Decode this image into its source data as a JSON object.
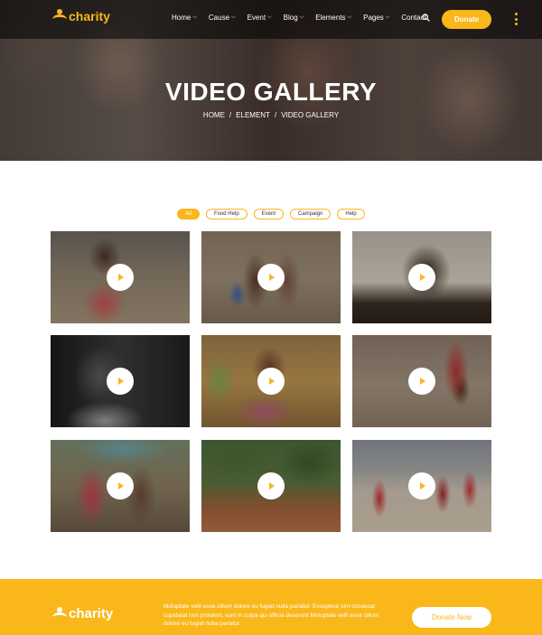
{
  "brand": {
    "name": "charity"
  },
  "nav": {
    "items": [
      {
        "label": "Home",
        "has_dropdown": true
      },
      {
        "label": "Cause",
        "has_dropdown": true
      },
      {
        "label": "Event",
        "has_dropdown": true
      },
      {
        "label": "Blog",
        "has_dropdown": true
      },
      {
        "label": "Elements",
        "has_dropdown": true
      },
      {
        "label": "Pages",
        "has_dropdown": true
      },
      {
        "label": "Contact",
        "has_dropdown": false
      }
    ],
    "search_icon": "search-icon",
    "donate_label": "Donate",
    "menu_icon": "vertical-dots-icon"
  },
  "hero": {
    "title": "VIDEO GALLERY",
    "breadcrumb": [
      "HOME",
      "ELEMENT",
      "VIDEO GALLERY"
    ],
    "separator": "/"
  },
  "filters": {
    "items": [
      "All",
      "Food Help",
      "Event",
      "Campaign",
      "Help"
    ],
    "active": "All"
  },
  "gallery": {
    "play_icon": "play-icon",
    "tiles": [
      {
        "name": "video-tile-1"
      },
      {
        "name": "video-tile-2"
      },
      {
        "name": "video-tile-3"
      },
      {
        "name": "video-tile-4"
      },
      {
        "name": "video-tile-5"
      },
      {
        "name": "video-tile-6"
      },
      {
        "name": "video-tile-7"
      },
      {
        "name": "video-tile-8"
      },
      {
        "name": "video-tile-9"
      }
    ]
  },
  "cta": {
    "logo_text": "charity",
    "text": "Moluptate velit esse cillum dolore eu fugiat nulla pariatur. Excepteur sint occaecat cupidatat non proident, sunt in culpa qui officia deserunt Moluptate velit esse cillum dolore eu fugiat nulla pariatur.",
    "button_label": "Donate Now"
  },
  "colors": {
    "accent": "#f9b71a",
    "white": "#ffffff"
  }
}
